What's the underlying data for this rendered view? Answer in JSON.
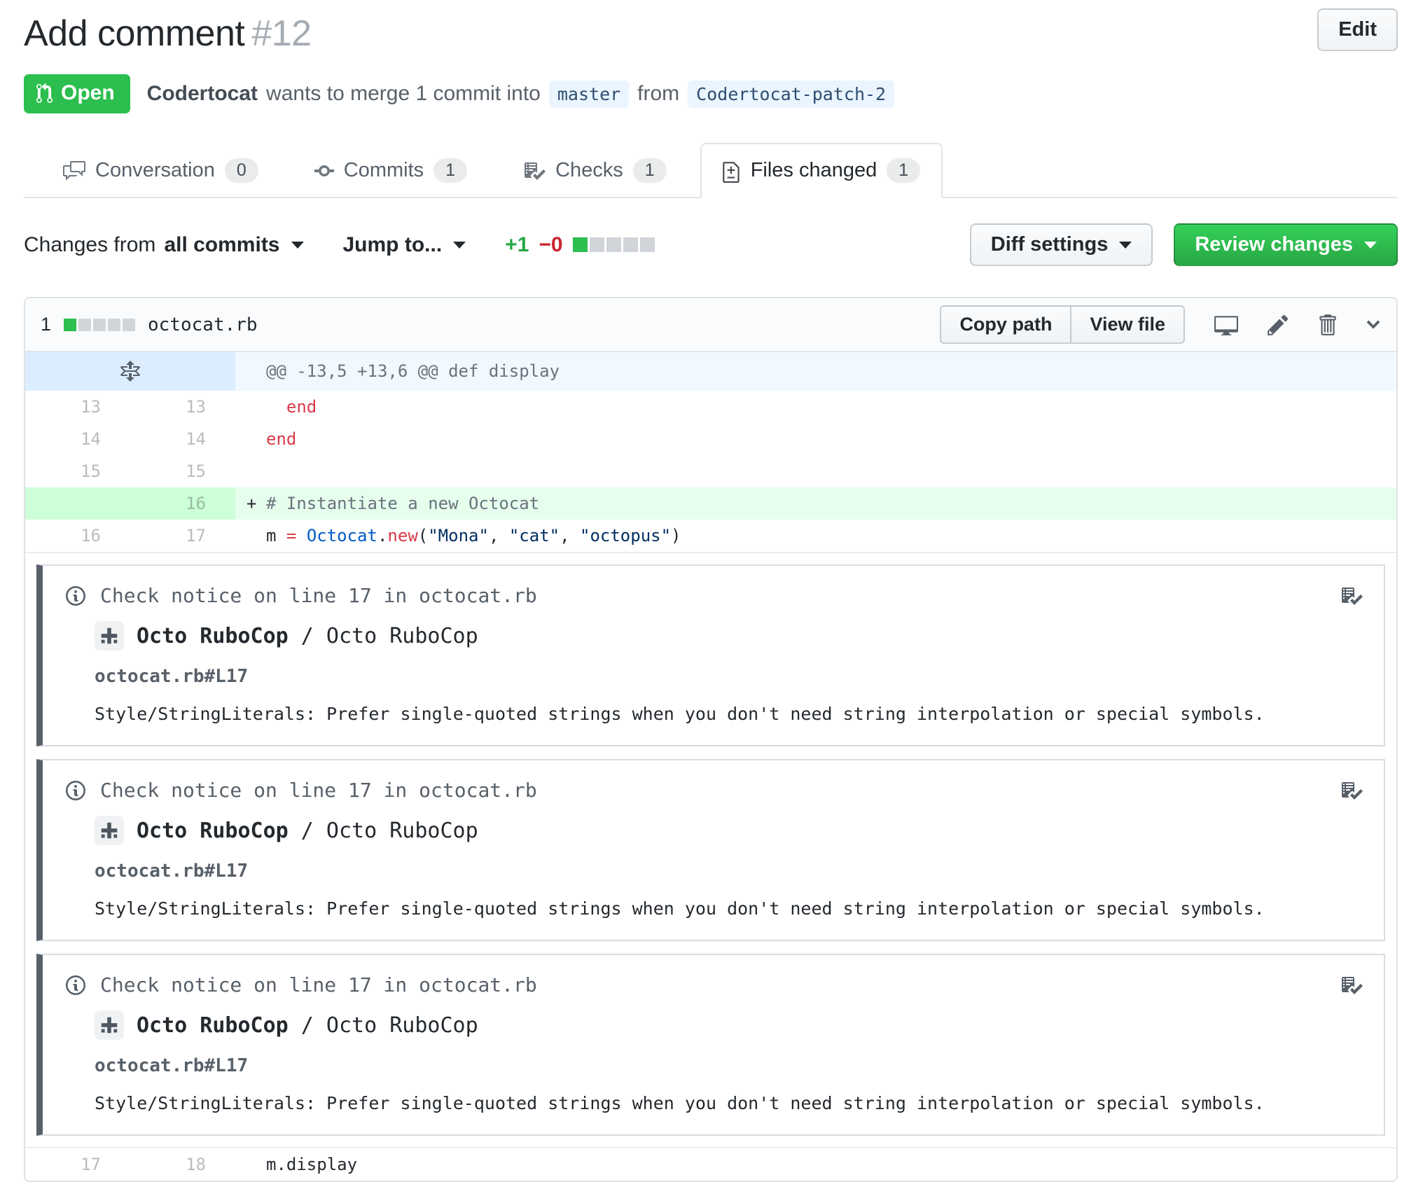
{
  "page": {
    "title": "Add comment",
    "number": "#12",
    "edit_button": "Edit"
  },
  "pr": {
    "state": "Open",
    "author": "Codertocat",
    "action": "wants to merge 1 commit into",
    "base_branch": "master",
    "from_word": "from",
    "head_branch": "Codertocat-patch-2"
  },
  "tabs": [
    {
      "label": "Conversation",
      "count": "0",
      "icon": "comment-discussion-icon",
      "active": false
    },
    {
      "label": "Commits",
      "count": "1",
      "icon": "git-commit-icon",
      "active": false
    },
    {
      "label": "Checks",
      "count": "1",
      "icon": "checklist-icon",
      "active": false
    },
    {
      "label": "Files changed",
      "count": "1",
      "icon": "file-diff-icon",
      "active": true
    }
  ],
  "toolbar": {
    "changes_from": "Changes from",
    "commit_range": "all commits",
    "jump_to": "Jump to...",
    "additions": "+1",
    "deletions": "−0",
    "diffstat_blocks": [
      "added",
      "neutral",
      "neutral",
      "neutral",
      "neutral"
    ],
    "diff_settings": "Diff settings",
    "review_changes": "Review changes"
  },
  "file": {
    "changed_files_count": "1",
    "name": "octocat.rb",
    "copy_path": "Copy path",
    "view_file": "View file",
    "diffstat_blocks": [
      "added",
      "neutral",
      "neutral",
      "neutral",
      "neutral"
    ],
    "action_icons": [
      "display-rich-diff-icon",
      "edit-file-icon",
      "delete-file-icon",
      "chevron-down-icon"
    ]
  },
  "diff": {
    "hunk_header": "@@ -13,5 +13,6 @@ def display",
    "rows_before": [
      {
        "old": "13",
        "new": "13",
        "type": "context",
        "prefix": "",
        "tokens": [
          [
            "  ",
            "plain"
          ],
          [
            "end",
            "keyword"
          ]
        ]
      },
      {
        "old": "14",
        "new": "14",
        "type": "context",
        "prefix": "",
        "tokens": [
          [
            "end",
            "keyword"
          ]
        ]
      },
      {
        "old": "15",
        "new": "15",
        "type": "context",
        "prefix": "",
        "tokens": []
      },
      {
        "old": "",
        "new": "16",
        "type": "addition",
        "prefix": "+",
        "tokens": [
          [
            "# Instantiate a new Octocat",
            "comment"
          ]
        ]
      },
      {
        "old": "16",
        "new": "17",
        "type": "context",
        "prefix": "",
        "tokens": [
          [
            "m ",
            "plain"
          ],
          [
            "=",
            "keyword"
          ],
          [
            " ",
            "plain"
          ],
          [
            "Octocat",
            "constant"
          ],
          [
            ".",
            "plain"
          ],
          [
            "new",
            "keyword"
          ],
          [
            "(",
            "plain"
          ],
          [
            "\"Mona\"",
            "string"
          ],
          [
            ", ",
            "plain"
          ],
          [
            "\"cat\"",
            "string"
          ],
          [
            ", ",
            "plain"
          ],
          [
            "\"octopus\"",
            "string"
          ],
          [
            ")",
            "plain"
          ]
        ]
      }
    ],
    "rows_after": [
      {
        "old": "17",
        "new": "18",
        "type": "context",
        "prefix": "",
        "tokens": [
          [
            "m.display",
            "plain"
          ]
        ]
      }
    ]
  },
  "check_notices": [
    {
      "title": "Check notice on line 17 in octocat.rb",
      "tool": "Octo RuboCop",
      "tool_suffix": " / Octo RuboCop",
      "location": "octocat.rb#L17",
      "message": "Style/StringLiterals: Prefer single-quoted strings when you don't need string interpolation or special symbols."
    },
    {
      "title": "Check notice on line 17 in octocat.rb",
      "tool": "Octo RuboCop",
      "tool_suffix": " / Octo RuboCop",
      "location": "octocat.rb#L17",
      "message": "Style/StringLiterals: Prefer single-quoted strings when you don't need string interpolation or special symbols."
    },
    {
      "title": "Check notice on line 17 in octocat.rb",
      "tool": "Octo RuboCop",
      "tool_suffix": " / Octo RuboCop",
      "location": "octocat.rb#L17",
      "message": "Style/StringLiterals: Prefer single-quoted strings when you don't need string interpolation or special symbols."
    }
  ],
  "colors": {
    "open_badge_green": "#2cbe4e",
    "primary_button_green": "#28a745",
    "additions_green": "#28a745",
    "deletions_red": "#cb2431",
    "branch_label_bg": "#eaf5ff",
    "branch_label_text": "#2f4d6f",
    "added_line_bg": "#e6ffed",
    "added_gutter_bg": "#cdffd8",
    "hunk_gutter_bg": "#dbedff",
    "hunk_line_bg": "#f1f8ff",
    "notice_bar": "#57606a"
  }
}
